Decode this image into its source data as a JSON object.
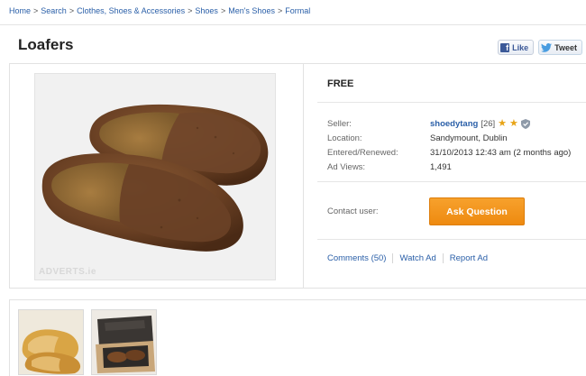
{
  "breadcrumb": [
    "Home",
    "Search",
    "Clothes, Shoes & Accessories",
    "Shoes",
    "Men's Shoes",
    "Formal"
  ],
  "breadcrumb_separator": ">",
  "ad": {
    "title": "Loafers",
    "price": "FREE",
    "watermark": "ADVERTS.ie"
  },
  "social": {
    "like_label": "Like",
    "tweet_label": "Tweet"
  },
  "details": {
    "seller_label": "Seller:",
    "seller_name": "shoedytang",
    "seller_feedback": "[26]",
    "seller_stars": 2,
    "location_label": "Location:",
    "location": "Sandymount, Dublin",
    "entered_label": "Entered/Renewed:",
    "entered": "31/10/2013 12:43 am (2 months ago)",
    "views_label": "Ad Views:",
    "views": "1,491"
  },
  "contact": {
    "label": "Contact user:",
    "button": "Ask Question"
  },
  "links": {
    "comments": "Comments (50)",
    "watch": "Watch Ad",
    "report": "Report Ad"
  },
  "colors": {
    "link": "#2a5fa8",
    "button": "#f29417",
    "star": "#e8a416"
  }
}
